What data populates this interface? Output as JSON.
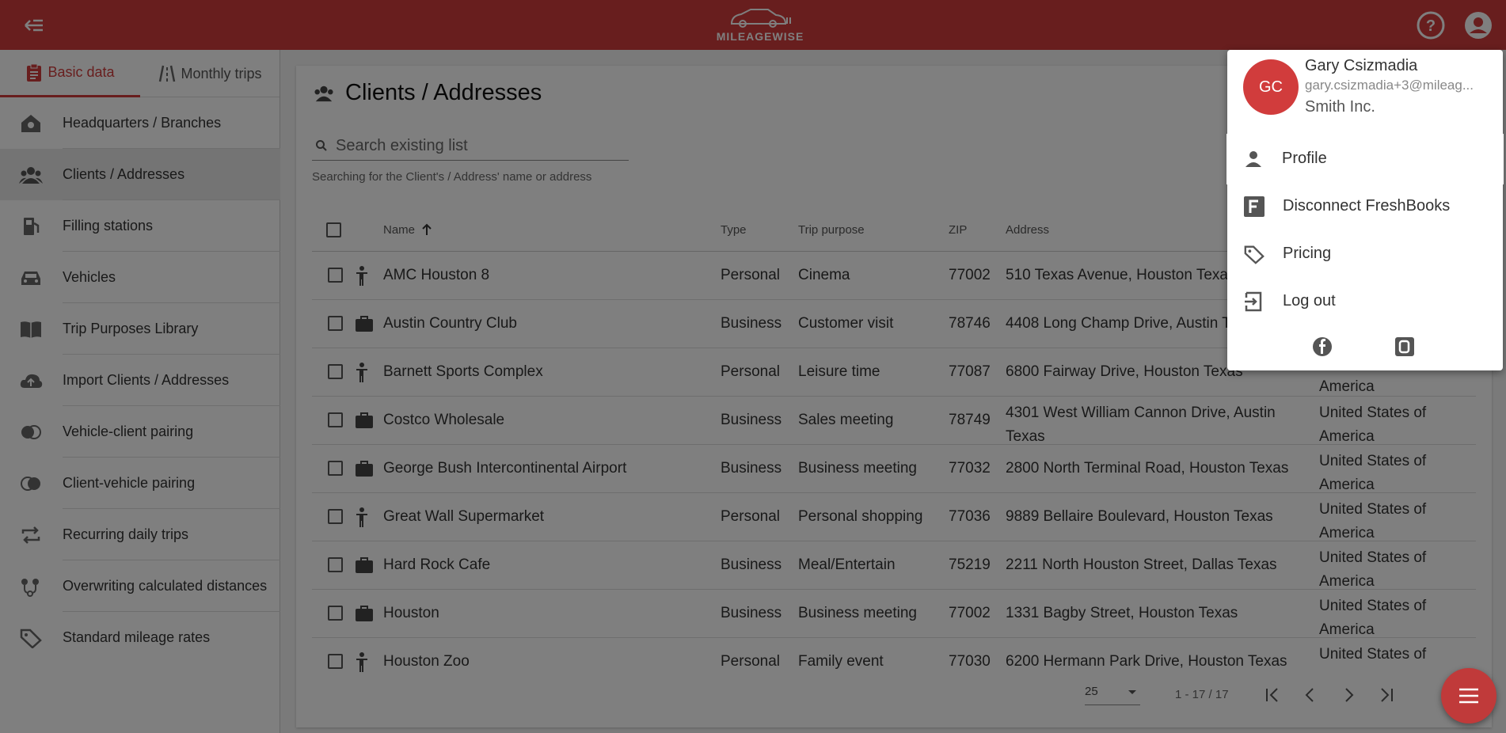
{
  "app": {
    "logo_text": "MILEAGEWISE",
    "brand_color": "#d13c3c"
  },
  "sidebar": {
    "tabs": [
      {
        "label": "Basic data"
      },
      {
        "label": "Monthly trips"
      }
    ],
    "items": [
      {
        "label": "Headquarters / Branches",
        "icon": "home-gear-icon"
      },
      {
        "label": "Clients / Addresses",
        "icon": "group-icon"
      },
      {
        "label": "Filling stations",
        "icon": "fuel-pump-icon"
      },
      {
        "label": "Vehicles",
        "icon": "car-icon"
      },
      {
        "label": "Trip Purposes Library",
        "icon": "book-icon"
      },
      {
        "label": "Import Clients / Addresses",
        "icon": "cloud-upload-icon"
      },
      {
        "label": "Vehicle-client pairing",
        "icon": "pairing-icon"
      },
      {
        "label": "Client-vehicle pairing",
        "icon": "pairing-icon"
      },
      {
        "label": "Recurring daily trips",
        "icon": "repeat-icon"
      },
      {
        "label": "Overwriting calculated distances",
        "icon": "route-icon"
      },
      {
        "label": "Standard mileage rates",
        "icon": "tag-icon"
      }
    ]
  },
  "main": {
    "title": "Clients / Addresses",
    "search_placeholder": "Search existing list",
    "search_hint": "Searching for the Client's / Address' name or address",
    "columns": {
      "name": "Name",
      "type": "Type",
      "purpose": "Trip purpose",
      "zip": "ZIP",
      "address": "Address"
    },
    "rows": [
      {
        "icon": "person-icon",
        "name": "AMC Houston 8",
        "type": "Personal",
        "purpose": "Cinema",
        "zip": "77002",
        "address": "510 Texas Avenue, Houston Texas",
        "country": ""
      },
      {
        "icon": "briefcase-icon",
        "name": "Austin Country Club",
        "type": "Business",
        "purpose": "Customer visit",
        "zip": "78746",
        "address": "4408 Long Champ Drive, Austin Texa",
        "country": ""
      },
      {
        "icon": "person-icon",
        "name": "Barnett Sports Complex",
        "type": "Personal",
        "purpose": "Leisure time",
        "zip": "77087",
        "address": "6800 Fairway Drive, Houston Texas",
        "country": "America"
      },
      {
        "icon": "briefcase-icon",
        "name": "Costco Wholesale",
        "type": "Business",
        "purpose": "Sales meeting",
        "zip": "78749",
        "address": "4301 West William Cannon Drive, Austin Texas",
        "country": "United States of America"
      },
      {
        "icon": "briefcase-icon",
        "name": "George Bush Intercontinental Airport",
        "type": "Business",
        "purpose": "Business meeting",
        "zip": "77032",
        "address": "2800 North Terminal Road, Houston Texas",
        "country": "United States of America"
      },
      {
        "icon": "person-icon",
        "name": "Great Wall Supermarket",
        "type": "Personal",
        "purpose": "Personal shopping",
        "zip": "77036",
        "address": "9889 Bellaire Boulevard, Houston Texas",
        "country": "United States of America"
      },
      {
        "icon": "briefcase-icon",
        "name": "Hard Rock Cafe",
        "type": "Business",
        "purpose": "Meal/Entertain",
        "zip": "75219",
        "address": "2211 North Houston Street, Dallas Texas",
        "country": "United States of America"
      },
      {
        "icon": "briefcase-icon",
        "name": "Houston",
        "type": "Business",
        "purpose": "Business meeting",
        "zip": "77002",
        "address": "1331 Bagby Street, Houston Texas",
        "country": "United States of America"
      },
      {
        "icon": "person-icon",
        "name": "Houston Zoo",
        "type": "Personal",
        "purpose": "Family event",
        "zip": "77030",
        "address": "6200 Hermann Park Drive, Houston Texas",
        "country": "United States of"
      }
    ],
    "pager": {
      "page_size": "25",
      "range": "1 - 17 / 17"
    }
  },
  "user_menu": {
    "initials": "GC",
    "name": "Gary Csizmadia",
    "email": "gary.csizmadia+3@mileag...",
    "company": "Smith Inc.",
    "items": [
      {
        "label": "Profile",
        "icon": "person-icon"
      },
      {
        "label": "Disconnect FreshBooks",
        "icon": "freshbooks-icon"
      },
      {
        "label": "Pricing",
        "icon": "tag-icon"
      },
      {
        "label": "Log out",
        "icon": "logout-icon"
      }
    ]
  }
}
